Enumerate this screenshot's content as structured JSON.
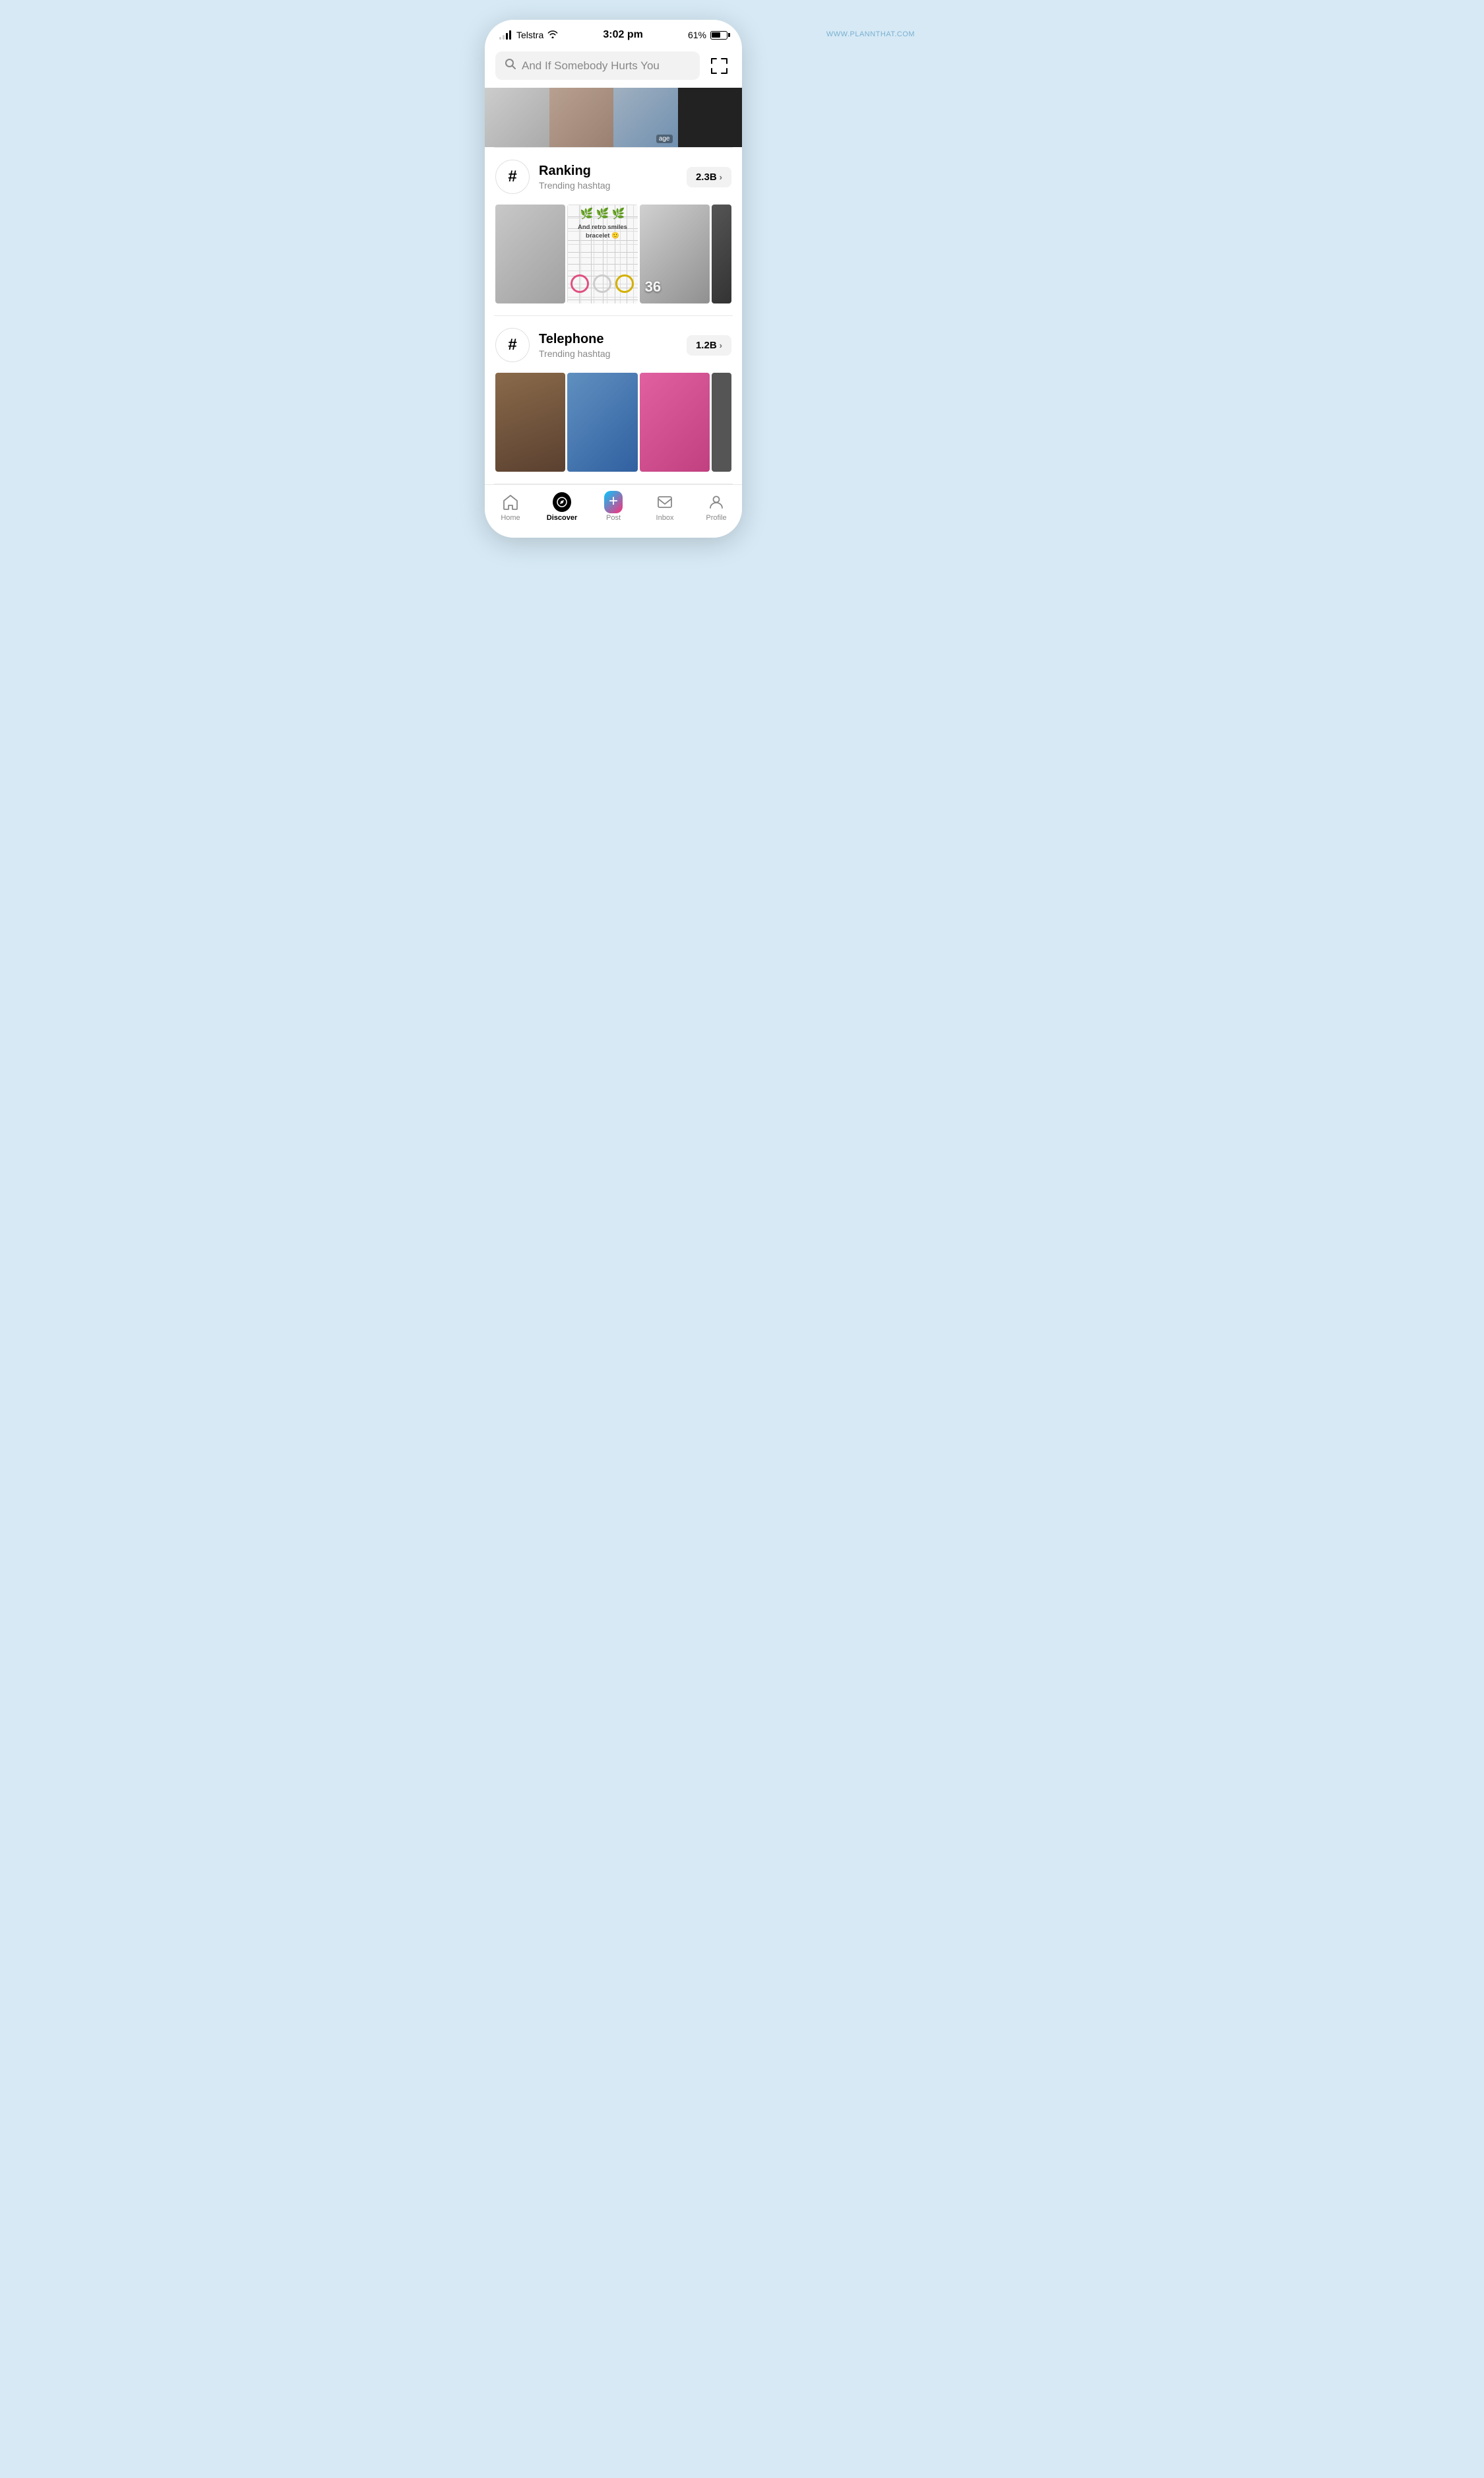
{
  "statusBar": {
    "carrier": "Telstra",
    "time": "3:02 pm",
    "battery": "61%"
  },
  "search": {
    "placeholder": "And If Somebody Hurts You",
    "scanLabel": "scan"
  },
  "sections": [
    {
      "id": "ranking",
      "title": "Ranking",
      "subtitle": "Trending hashtag",
      "count": "2.3B",
      "symbol": "#"
    },
    {
      "id": "telephone",
      "title": "Telephone",
      "subtitle": "Trending hashtag",
      "count": "1.2B",
      "symbol": "#"
    }
  ],
  "nav": {
    "home": "Home",
    "discover": "Discover",
    "post": "Post",
    "inbox": "Inbox",
    "profile": "Profile"
  },
  "footer": "WWW.PLANNTHAT.COM",
  "grid1": {
    "img2text": "And retro smiles bracelet 🙂"
  }
}
